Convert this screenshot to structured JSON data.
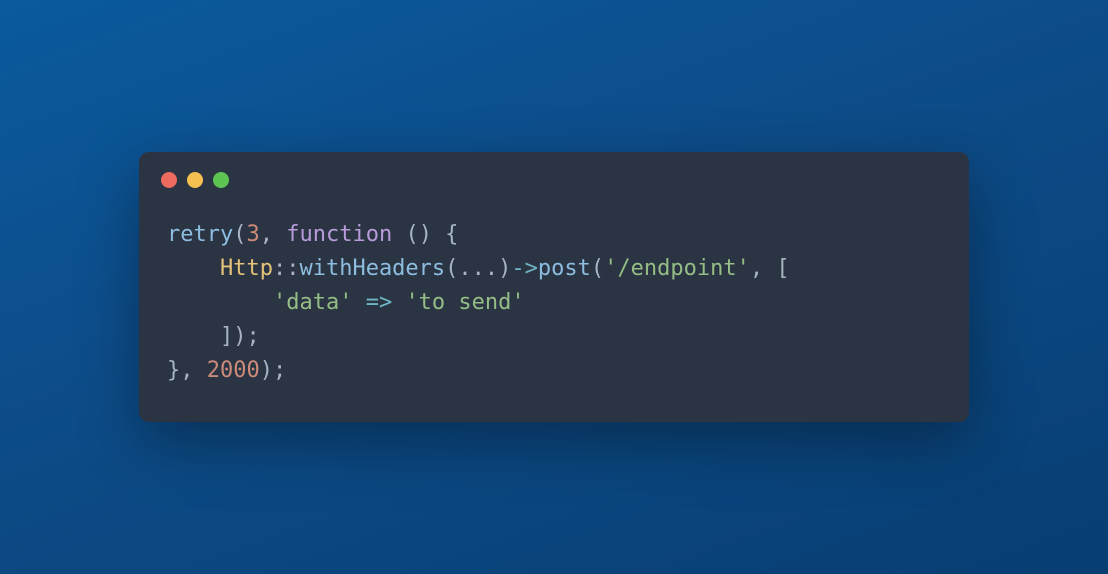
{
  "window": {
    "traffic": [
      "close",
      "minimize",
      "zoom"
    ]
  },
  "code": {
    "line1": {
      "retry": "retry",
      "p1": "(",
      "n3": "3",
      "c1": ", ",
      "func": "function",
      "rest": " () {"
    },
    "line2": {
      "indent": "    ",
      "http": "Http",
      "s1": "::",
      "with": "withHeaders",
      "p1": "(",
      "dots": "...",
      "p2": ")",
      "arrow": "->",
      "post": "post",
      "p3": "(",
      "ep": "'/endpoint'",
      "rest": ", ["
    },
    "line3": {
      "indent": "        ",
      "k": "'data'",
      "arrow": " => ",
      "v": "'to send'"
    },
    "line4": {
      "indent": "    ",
      "rest": "]);"
    },
    "line5": {
      "close": "}, ",
      "n2000": "2000",
      "rest": ");"
    }
  }
}
